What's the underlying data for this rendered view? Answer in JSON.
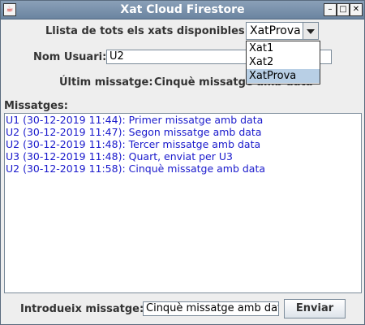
{
  "window": {
    "title": "Xat Cloud Firestore",
    "buttons": {
      "minimize": "–",
      "maximize": "□",
      "close": "✕"
    }
  },
  "chat_select": {
    "label": "Llista de tots els xats disponibles:",
    "selected": "XatProva",
    "options": [
      "Xat1",
      "Xat2",
      "XatProva"
    ]
  },
  "user": {
    "label": "Nom Usuari:",
    "value": "U2"
  },
  "last_message": {
    "label": "Últim missatge:",
    "value": "Cinquè missatge amb data"
  },
  "messages": {
    "label": "Missatges:",
    "items": [
      "U1 (30-12-2019 11:44): Primer missatge amb data",
      "U2 (30-12-2019 11:47): Segon missatge amb data",
      "U2 (30-12-2019 11:48): Tercer missatge amb data",
      "U3 (30-12-2019 11:48): Quart, enviat per U3",
      "U2 (30-12-2019 11:58): Cinquè missatge amb data"
    ]
  },
  "compose": {
    "label": "Introdueix missatge:",
    "value": "Cinquè missatge amb data",
    "send_label": "Enviar"
  },
  "colors": {
    "title_bar": "#7a92ad",
    "message_text": "#1a1acc",
    "selected_option": "#b8cfe5"
  }
}
